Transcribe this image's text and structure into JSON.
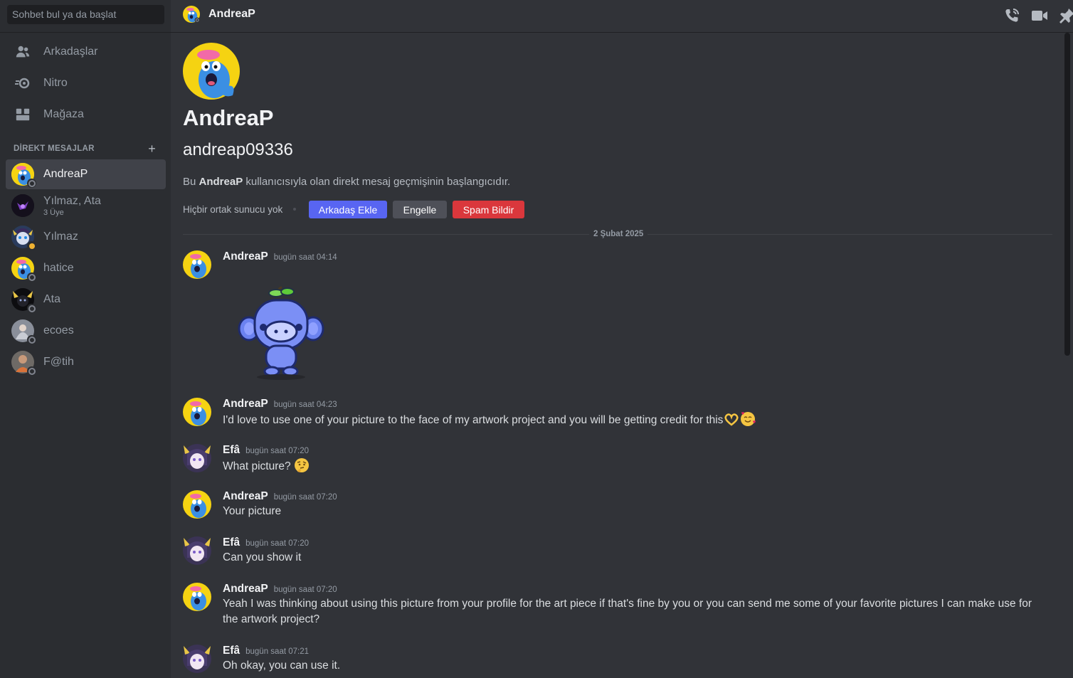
{
  "search": {
    "placeholder": "Sohbet bul ya da başlat"
  },
  "nav": [
    {
      "label": "Arkadaşlar",
      "icon": "friends-icon"
    },
    {
      "label": "Nitro",
      "icon": "nitro-icon"
    },
    {
      "label": "Mağaza",
      "icon": "shop-icon"
    }
  ],
  "dm_section": {
    "title": "DİREKT MESAJLAR",
    "add": "+"
  },
  "dms": [
    {
      "name": "AndreaP",
      "sub": "",
      "active": true,
      "status": "offline"
    },
    {
      "name": "Yılmaz, Ata",
      "sub": "3 Üye",
      "active": false,
      "status": "none"
    },
    {
      "name": "Yılmaz",
      "sub": "",
      "active": false,
      "status": "idle"
    },
    {
      "name": "hatice",
      "sub": "",
      "active": false,
      "status": "offline"
    },
    {
      "name": "Ata",
      "sub": "",
      "active": false,
      "status": "offline"
    },
    {
      "name": "ecoes",
      "sub": "",
      "active": false,
      "status": "offline"
    },
    {
      "name": "F@tih",
      "sub": "",
      "active": false,
      "status": "offline"
    }
  ],
  "header": {
    "title": "AndreaP"
  },
  "profile": {
    "display_name": "AndreaP",
    "username": "andreap09336",
    "desc_prefix": "Bu ",
    "desc_name": "AndreaP",
    "desc_suffix": " kullanıcısıyla olan direkt mesaj geçmişinin başlangıcıdır.",
    "mutual": "Hiçbir ortak sunucu yok",
    "add_friend": "Arkadaş Ekle",
    "block": "Engelle",
    "report_spam": "Spam Bildir"
  },
  "date_divider": "2 Şubat 2025",
  "messages": [
    {
      "author": "AndreaP",
      "time": "bugün saat 04:14",
      "text": "",
      "sticker": true
    },
    {
      "author": "AndreaP",
      "time": "bugün saat 04:23",
      "text": "I'd love to use one of your picture  to the face of my artwork project and you will be getting credit for this"
    },
    {
      "author": "Efâ",
      "time": "bugün saat 07:20",
      "text": "What picture?"
    },
    {
      "author": "AndreaP",
      "time": "bugün saat 07:20",
      "text": "Your picture"
    },
    {
      "author": "Efâ",
      "time": "bugün saat 07:20",
      "text": "Can you show it"
    },
    {
      "author": "AndreaP",
      "time": "bugün saat 07:20",
      "text": "Yeah I was thinking about using this picture from your profile for the art piece if that's fine by you or you can send me some of your favorite pictures I can make use for the artwork project?"
    },
    {
      "author": "Efâ",
      "time": "bugün saat 07:21",
      "text": "Oh okay, you can use it."
    }
  ],
  "colors": {
    "accent": "#5865f2",
    "danger": "#da373c",
    "neutral": "#4e5058"
  }
}
